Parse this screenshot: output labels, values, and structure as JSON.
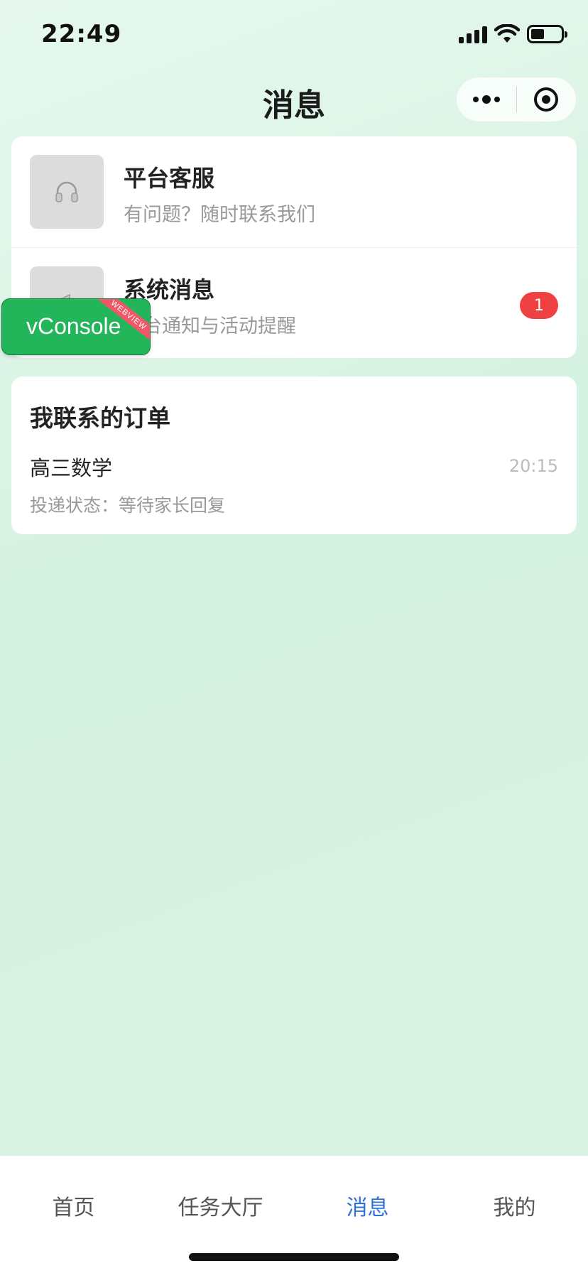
{
  "status_bar": {
    "time": "22:49"
  },
  "nav": {
    "title": "消息"
  },
  "service_messages": [
    {
      "title": "平台客服",
      "subtitle": "有问题？随时联系我们",
      "icon": "headphones-icon",
      "badge": ""
    },
    {
      "title": "系统消息",
      "subtitle": "平台通知与活动提醒",
      "icon": "megaphone-icon",
      "badge": "1"
    }
  ],
  "orders": {
    "title": "我联系的订单",
    "items": [
      {
        "name": "高三数学",
        "time": "20:15",
        "status": "投递状态：等待家长回复"
      }
    ]
  },
  "vconsole": {
    "label": "vConsole",
    "ribbon": "WEBVIEW"
  },
  "tabbar": {
    "items": [
      {
        "label": "首页",
        "active": false
      },
      {
        "label": "任务大厅",
        "active": false
      },
      {
        "label": "消息",
        "active": true
      },
      {
        "label": "我的",
        "active": false
      }
    ]
  },
  "colors": {
    "badge": "#f04142",
    "active_tab": "#2f72d6",
    "vconsole": "#23b55a"
  }
}
